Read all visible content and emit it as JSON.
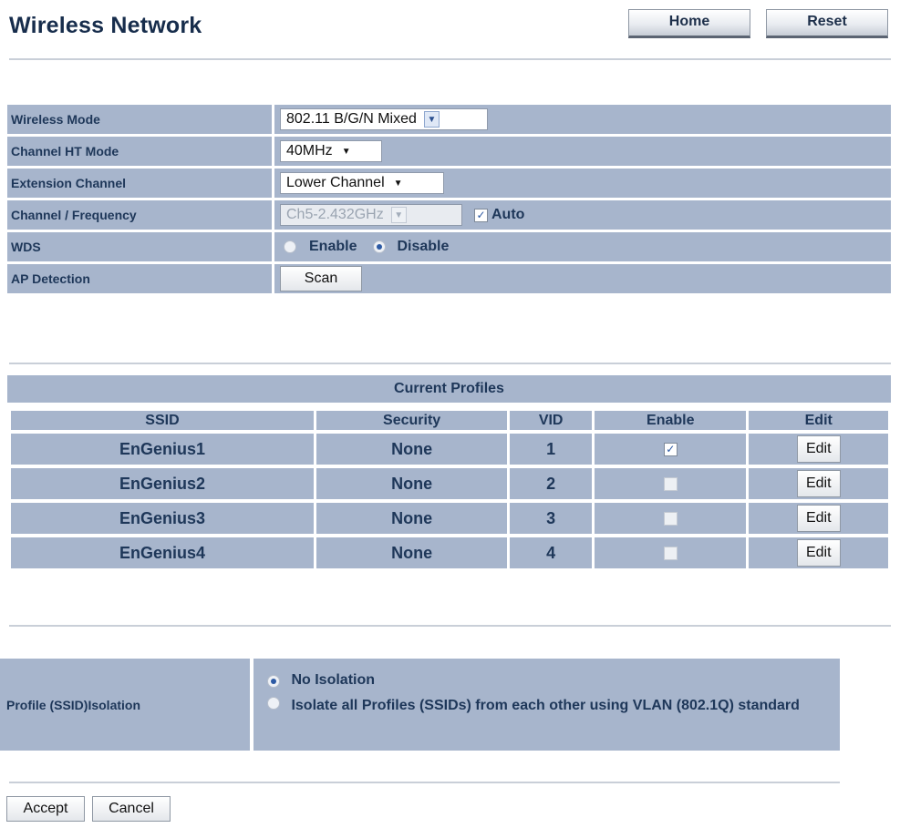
{
  "header": {
    "title": "Wireless Network",
    "home_label": "Home",
    "reset_label": "Reset"
  },
  "settings": {
    "wireless_mode": {
      "label": "Wireless Mode",
      "value": "802.11 B/G/N Mixed"
    },
    "channel_ht_mode": {
      "label": "Channel HT Mode",
      "value": "40MHz"
    },
    "extension_channel": {
      "label": "Extension Channel",
      "value": "Lower Channel"
    },
    "channel_frequency": {
      "label": "Channel / Frequency",
      "value": "Ch5-2.432GHz",
      "auto_label": "Auto",
      "auto_checked": true
    },
    "wds": {
      "label": "WDS",
      "enable_label": "Enable",
      "disable_label": "Disable",
      "selected": "Disable"
    },
    "ap_detection": {
      "label": "AP Detection",
      "scan_label": "Scan"
    }
  },
  "profiles": {
    "title": "Current Profiles",
    "columns": [
      "SSID",
      "Security",
      "VID",
      "Enable",
      "Edit"
    ],
    "rows": [
      {
        "ssid": "EnGenius1",
        "security": "None",
        "vid": "1",
        "enabled": true,
        "edit": "Edit"
      },
      {
        "ssid": "EnGenius2",
        "security": "None",
        "vid": "2",
        "enabled": false,
        "edit": "Edit"
      },
      {
        "ssid": "EnGenius3",
        "security": "None",
        "vid": "3",
        "enabled": false,
        "edit": "Edit"
      },
      {
        "ssid": "EnGenius4",
        "security": "None",
        "vid": "4",
        "enabled": false,
        "edit": "Edit"
      }
    ]
  },
  "isolation": {
    "label": "Profile (SSID)Isolation",
    "option_none": "No Isolation",
    "option_vlan": "Isolate all Profiles (SSIDs) from each other using VLAN (802.1Q) standard",
    "selected": "No Isolation"
  },
  "footer": {
    "accept_label": "Accept",
    "cancel_label": "Cancel"
  }
}
